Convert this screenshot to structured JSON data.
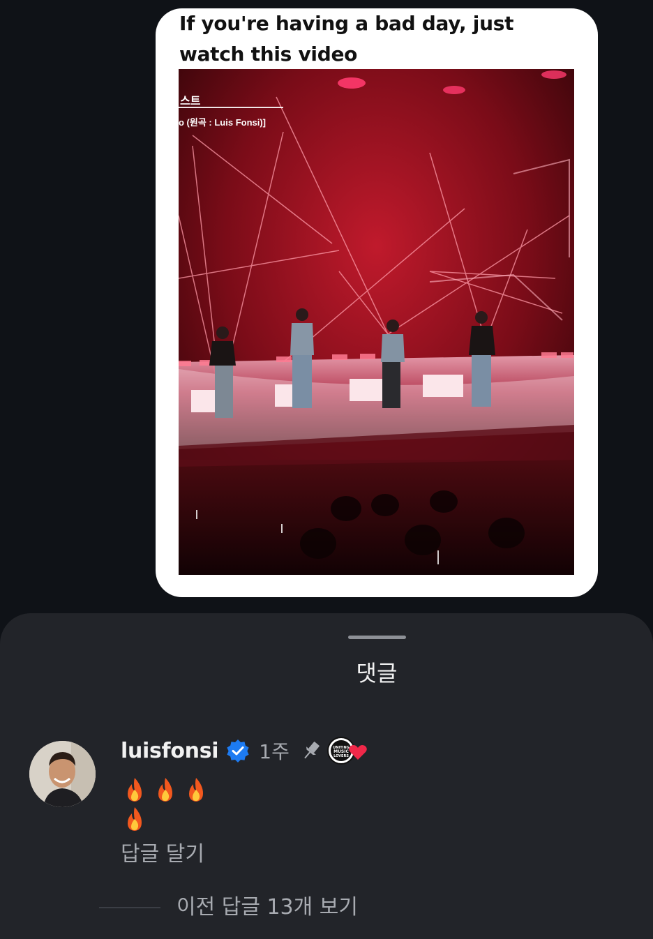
{
  "post": {
    "caption": "If you're having a bad day, just watch this video",
    "video_overlay_line1": "스트",
    "video_overlay_line2": "o (원곡 : Luis Fonsi)]"
  },
  "sheet": {
    "title": "댓글"
  },
  "comment": {
    "username": "luisfonsi",
    "timestamp": "1주",
    "liked_badge_text": "UNITING MUSIC LOVERS",
    "reply_label": "답글 달기",
    "view_replies_label": "이전 답글 13개 보기"
  },
  "icons": {
    "verified": "verified-badge-icon",
    "pin": "pin-icon",
    "flame": "fire-emoji",
    "heart": "heart-icon"
  },
  "colors": {
    "background": "#0f1217",
    "sheet": "#222429",
    "verified_blue": "#1d7bf2",
    "heart_red": "#f02849",
    "muted_text": "#a8abb1"
  }
}
